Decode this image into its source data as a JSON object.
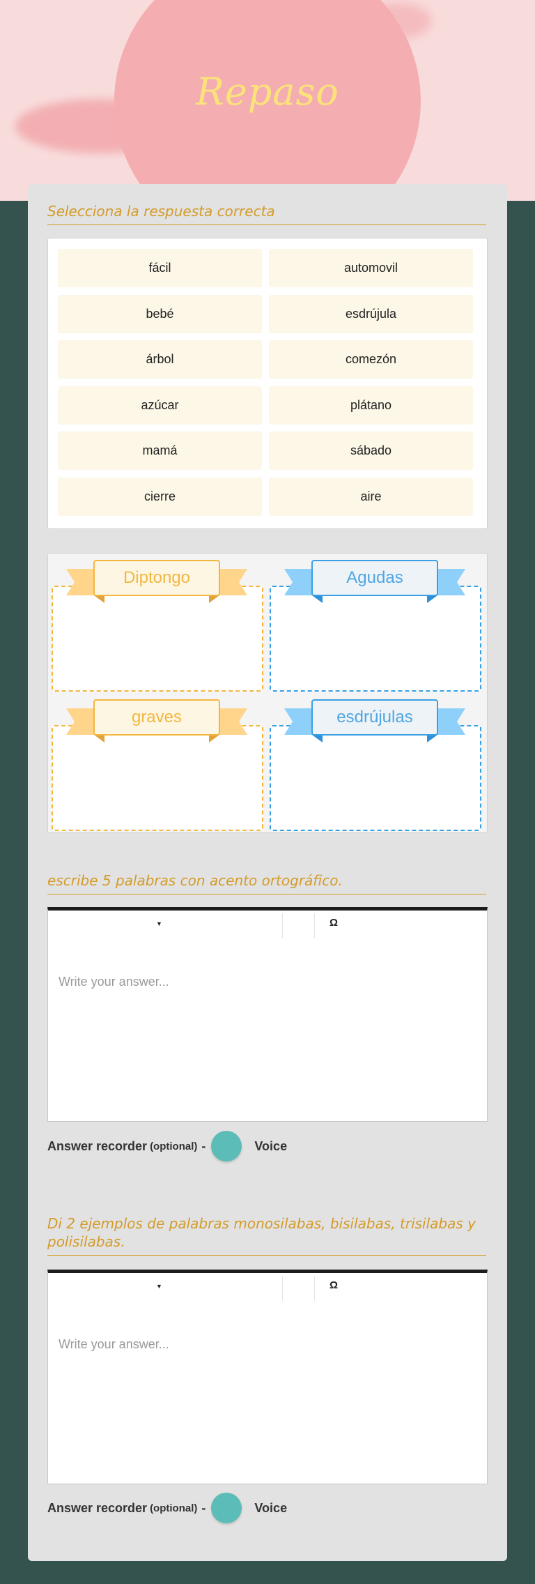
{
  "header": {
    "title": "Repaso"
  },
  "q1": {
    "instruction": "Selecciona la respuesta correcta",
    "words": [
      "fácil",
      "automovil",
      "bebé",
      "esdrújula",
      "árbol",
      "comezón",
      "azúcar",
      "plátano",
      "mamá",
      "sábado",
      "cierre",
      "aire"
    ],
    "categories": [
      "Diptongo",
      "Agudas",
      "graves",
      "esdrújulas"
    ]
  },
  "q2": {
    "prompt": "escribe 5 palabras con acento ortográfico.",
    "toolbar_symbol": "Ω",
    "placeholder": "Write your answer...",
    "recorder_label": "Answer recorder",
    "recorder_optional": "(optional)",
    "recorder_dash": "-",
    "recorder_voice": "Voice"
  },
  "q3": {
    "prompt": "Di 2 ejemplos de palabras monosilabas, bisilabas, trisilabas y polisilabas.",
    "toolbar_symbol": "Ω",
    "placeholder": "Write your answer...",
    "recorder_label": "Answer recorder",
    "recorder_optional": "(optional)",
    "recorder_dash": "-",
    "recorder_voice": "Voice"
  },
  "colors": {
    "background": "#34534f",
    "header_pink": "#f4aeb1",
    "title_yellow": "#fbe37a",
    "accent_orange": "#d39b2a",
    "gold": "#f3b741",
    "blue": "#39a0e4",
    "recorder_teal": "#5cbcb7"
  }
}
